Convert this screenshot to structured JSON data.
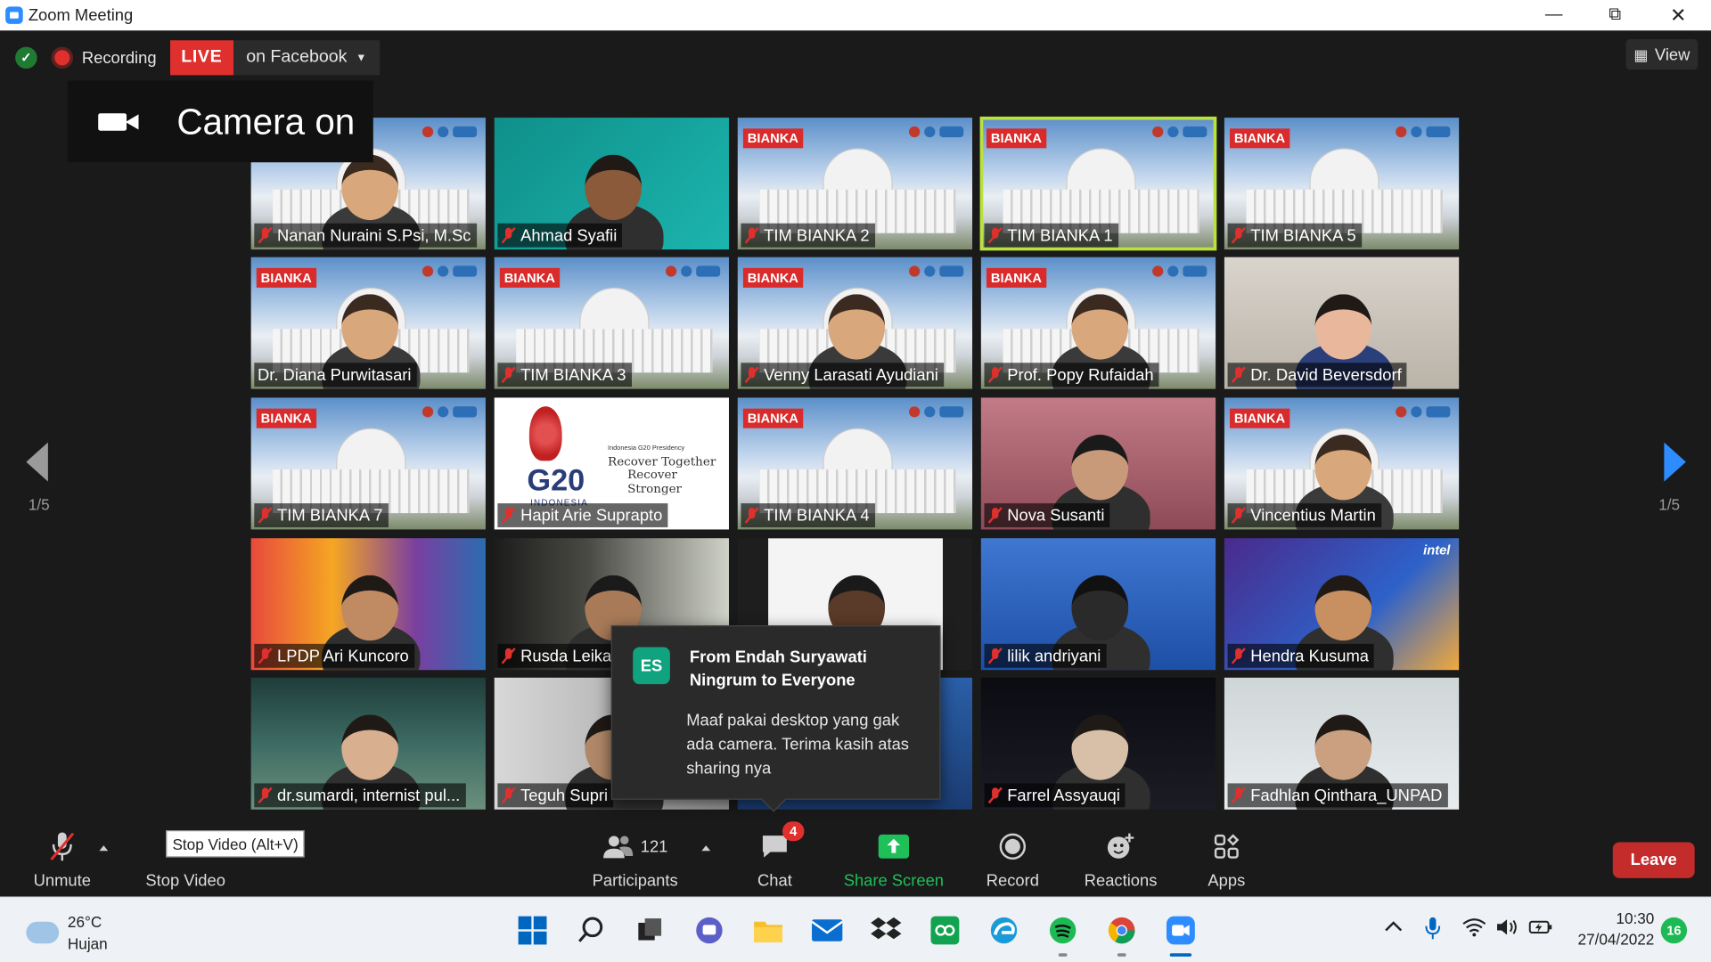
{
  "window": {
    "title": "Zoom Meeting"
  },
  "topbar": {
    "recording_label": "Recording",
    "live_badge": "LIVE",
    "live_destination": "on Facebook",
    "view_label": "View"
  },
  "camera_toast": {
    "text": "Camera on"
  },
  "pagination": {
    "left": "1/5",
    "right": "1/5"
  },
  "participants": [
    {
      "name": "Nanan Nuraini S.Psi, M.Sc",
      "muted": true,
      "bg": "bianka"
    },
    {
      "name": "Ahmad Syafii",
      "muted": true,
      "bg": "teal"
    },
    {
      "name": "TIM BIANKA 2",
      "muted": true,
      "bg": "bianka"
    },
    {
      "name": "TIM BIANKA 1",
      "muted": true,
      "bg": "bianka",
      "active_speaker": true
    },
    {
      "name": "TIM BIANKA 5",
      "muted": true,
      "bg": "bianka"
    },
    {
      "name": "Dr. Diana Purwitasari",
      "muted": false,
      "bg": "bianka"
    },
    {
      "name": "TIM BIANKA 3",
      "muted": true,
      "bg": "bianka"
    },
    {
      "name": "Venny Larasati Ayudiani",
      "muted": true,
      "bg": "bianka"
    },
    {
      "name": "Prof. Popy Rufaidah",
      "muted": true,
      "bg": "bianka"
    },
    {
      "name": "Dr. David Beversdorf",
      "muted": true,
      "bg": "office"
    },
    {
      "name": "TIM BIANKA 7",
      "muted": true,
      "bg": "bianka"
    },
    {
      "name": "Hapit Arie Suprapto",
      "muted": true,
      "bg": "g20"
    },
    {
      "name": "TIM BIANKA 4",
      "muted": true,
      "bg": "bianka"
    },
    {
      "name": "Nova Susanti",
      "muted": true,
      "bg": "crowd"
    },
    {
      "name": "Vincentius Martin",
      "muted": true,
      "bg": "bianka"
    },
    {
      "name": "LPDP Ari Kuncoro",
      "muted": true,
      "bg": "colorful"
    },
    {
      "name": "Rusda Leika",
      "muted": true,
      "bg": "studio"
    },
    {
      "name": "",
      "muted": false,
      "bg": "white-room"
    },
    {
      "name": "lilik andriyani",
      "muted": true,
      "bg": "blue-temple"
    },
    {
      "name": "Hendra Kusuma",
      "muted": true,
      "bg": "purple-slide"
    },
    {
      "name": "dr.sumardi, internist pul...",
      "muted": true,
      "bg": "underwater"
    },
    {
      "name": "Teguh Supri",
      "muted": true,
      "bg": "gray"
    },
    {
      "name": "",
      "muted": false,
      "bg": "blue"
    },
    {
      "name": "Farrel Assyauqi",
      "muted": true,
      "bg": "night"
    },
    {
      "name": "Fadhlan Qinthara_UNPAD",
      "muted": true,
      "bg": "light"
    }
  ],
  "tile_texts": {
    "bianka_brand": "BIANKA",
    "g20_title": "G20",
    "g20_sub": "INDONESIA",
    "g20_line1": "Recover Together",
    "g20_line2": "Recover Stronger",
    "g20_small": "Indonesia G20 Presidency",
    "intel": "intel"
  },
  "chat": {
    "avatar_initials": "ES",
    "from": "From Endah Suryawati Ningrum to Everyone",
    "message": "Maaf pakai desktop yang gak ada camera. Terima kasih atas sharing nya"
  },
  "toolbar": {
    "unmute": "Unmute",
    "stop_video": "Stop Video",
    "tooltip": "Stop Video (Alt+V)",
    "participants": "Participants",
    "participants_count": "121",
    "chat": "Chat",
    "chat_badge": "4",
    "share_screen": "Share Screen",
    "record": "Record",
    "reactions": "Reactions",
    "apps": "Apps",
    "leave": "Leave"
  },
  "taskbar": {
    "weather_temp": "26°C",
    "weather_desc": "Hujan",
    "time": "10:30",
    "date": "27/04/2022",
    "notifications": "16"
  },
  "colors": {
    "accent_blue": "#2d8cff",
    "live_red": "#e0302d",
    "share_green": "#1fbf5a",
    "active_speaker": "#b9e23f",
    "leave_red": "#c42b2b"
  }
}
